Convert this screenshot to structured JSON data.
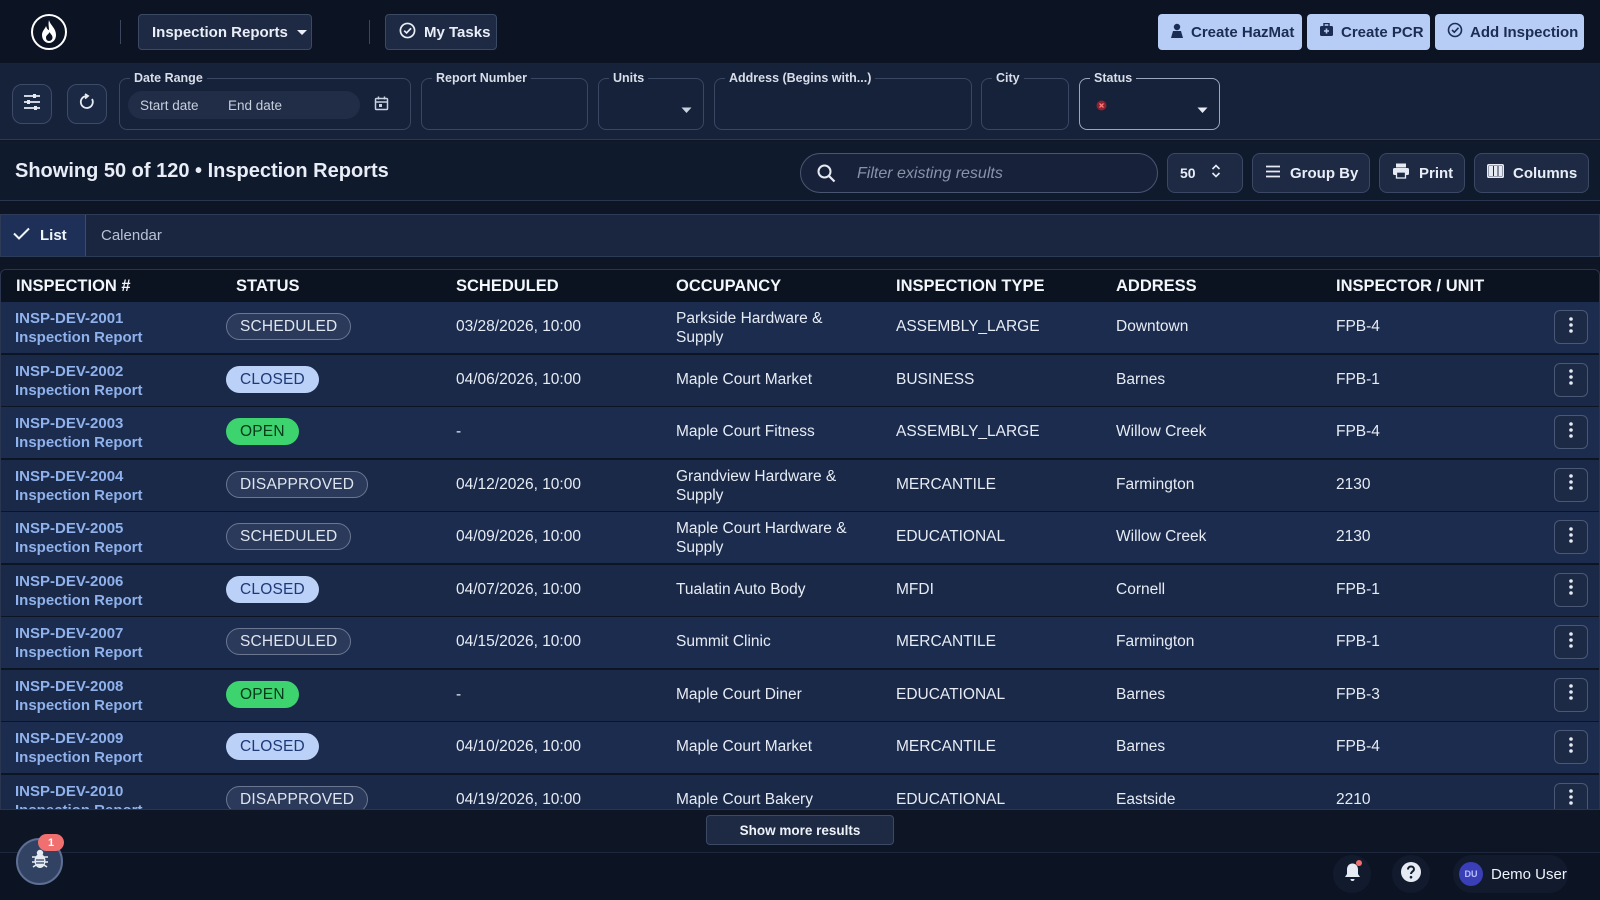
{
  "header": {
    "module_select_label": "Inspection Reports",
    "my_tasks_label": "My Tasks",
    "create_hazmat_label": "Create HazMat",
    "create_pcr_label": "Create PCR",
    "add_inspection_label": "Add Inspection"
  },
  "filters": {
    "date_range_label": "Date Range",
    "start_date_placeholder": "Start date",
    "end_date_placeholder": "End date",
    "report_number_label": "Report Number",
    "report_number_value": "",
    "units_label": "Units",
    "units_value": "",
    "address_label": "Address (Begins with...)",
    "address_value": "",
    "city_label": "City",
    "city_value": "",
    "status_label": "Status",
    "status_value": ""
  },
  "results": {
    "title": "Showing 50 of 120 • Inspection Reports",
    "search_placeholder": "Filter existing results",
    "page_size": "50",
    "group_by_label": "Group By",
    "print_label": "Print",
    "columns_label": "Columns"
  },
  "view_tabs": {
    "list_label": "List",
    "calendar_label": "Calendar"
  },
  "table": {
    "columns": [
      "INSPECTION #",
      "STATUS",
      "SCHEDULED",
      "OCCUPANCY",
      "INSPECTION TYPE",
      "ADDRESS",
      "INSPECTOR / UNIT"
    ],
    "rows": [
      {
        "id": "INSP-DEV-2001",
        "sub": "Inspection Report",
        "status": "SCHEDULED",
        "scheduled": "03/28/2026, 10:00",
        "occupancy": "Parkside Hardware & Supply",
        "type": "ASSEMBLY_LARGE",
        "address": "Downtown",
        "unit": "FPB-4"
      },
      {
        "id": "INSP-DEV-2002",
        "sub": "Inspection Report",
        "status": "CLOSED",
        "scheduled": "04/06/2026, 10:00",
        "occupancy": "Maple Court Market",
        "type": "BUSINESS",
        "address": "Barnes",
        "unit": "FPB-1"
      },
      {
        "id": "INSP-DEV-2003",
        "sub": "Inspection Report",
        "status": "OPEN",
        "scheduled": "-",
        "occupancy": "Maple Court Fitness",
        "type": "ASSEMBLY_LARGE",
        "address": "Willow Creek",
        "unit": "FPB-4"
      },
      {
        "id": "INSP-DEV-2004",
        "sub": "Inspection Report",
        "status": "DISAPPROVED",
        "scheduled": "04/12/2026, 10:00",
        "occupancy": "Grandview Hardware & Supply",
        "type": "MERCANTILE",
        "address": "Farmington",
        "unit": "2130"
      },
      {
        "id": "INSP-DEV-2005",
        "sub": "Inspection Report",
        "status": "SCHEDULED",
        "scheduled": "04/09/2026, 10:00",
        "occupancy": "Maple Court Hardware & Supply",
        "type": "EDUCATIONAL",
        "address": "Willow Creek",
        "unit": "2130"
      },
      {
        "id": "INSP-DEV-2006",
        "sub": "Inspection Report",
        "status": "CLOSED",
        "scheduled": "04/07/2026, 10:00",
        "occupancy": "Tualatin Auto Body",
        "type": "MFDI",
        "address": "Cornell",
        "unit": "FPB-1"
      },
      {
        "id": "INSP-DEV-2007",
        "sub": "Inspection Report",
        "status": "SCHEDULED",
        "scheduled": "04/15/2026, 10:00",
        "occupancy": "Summit Clinic",
        "type": "MERCANTILE",
        "address": "Farmington",
        "unit": "FPB-1"
      },
      {
        "id": "INSP-DEV-2008",
        "sub": "Inspection Report",
        "status": "OPEN",
        "scheduled": "-",
        "occupancy": "Maple Court Diner",
        "type": "EDUCATIONAL",
        "address": "Barnes",
        "unit": "FPB-3"
      },
      {
        "id": "INSP-DEV-2009",
        "sub": "Inspection Report",
        "status": "CLOSED",
        "scheduled": "04/10/2026, 10:00",
        "occupancy": "Maple Court Market",
        "type": "MERCANTILE",
        "address": "Barnes",
        "unit": "FPB-4"
      },
      {
        "id": "INSP-DEV-2010",
        "sub": "Inspection Report",
        "status": "DISAPPROVED",
        "scheduled": "04/19/2026, 10:00",
        "occupancy": "Maple Court Bakery",
        "type": "EDUCATIONAL",
        "address": "Eastside",
        "unit": "2210"
      }
    ]
  },
  "show_more_label": "Show more results",
  "footer": {
    "bug_badge_count": "1",
    "user_initials": "DU",
    "user_name": "Demo User"
  },
  "icons": [
    "flame-logo-icon",
    "chevron-down-icon",
    "check-circle-icon",
    "person-icon",
    "medkit-icon",
    "calendar-check-icon",
    "sliders-icon",
    "refresh-icon",
    "calendar-icon",
    "search-icon",
    "up-down-chevron-icon",
    "list-icon",
    "printer-icon",
    "columns-icon",
    "check-icon",
    "more-vertical-icon",
    "bug-icon",
    "bell-icon",
    "help-icon"
  ],
  "colors": {
    "background": "#0e1626",
    "accent_button": "#b7cdf6",
    "open_status": "#3dd36f",
    "closed_status": "#bcd1f7",
    "link": "#8fb2ec"
  }
}
